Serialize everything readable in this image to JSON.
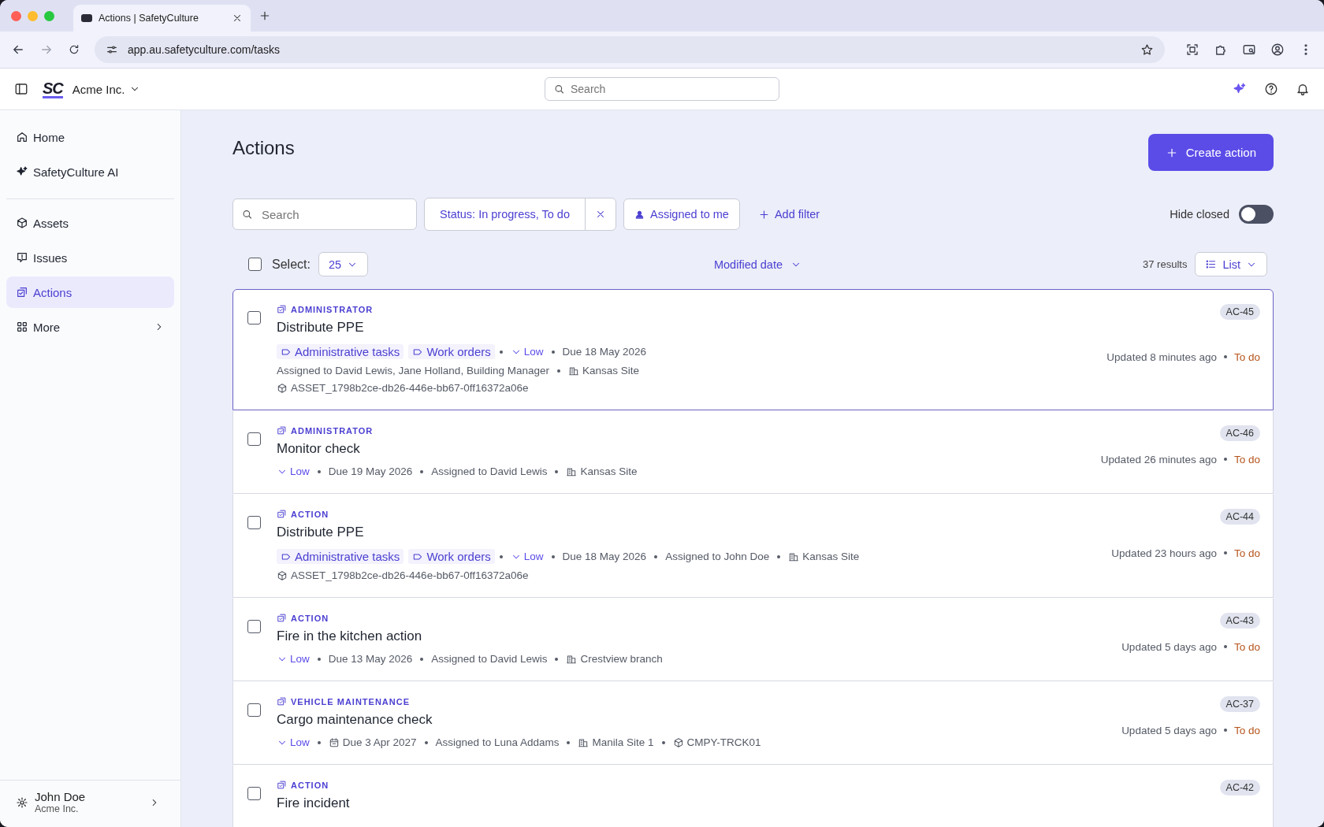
{
  "browser": {
    "tab_title": "Actions | SafetyCulture",
    "url": "app.au.safetyculture.com/tasks"
  },
  "header": {
    "logo": "SC",
    "org": "Acme Inc.",
    "search_placeholder": "Search"
  },
  "sidebar": {
    "groups": [
      [
        {
          "label": "Home",
          "selected": false,
          "expandable": false
        },
        {
          "label": "SafetyCulture AI",
          "selected": false,
          "expandable": false
        }
      ],
      [
        {
          "label": "Assets",
          "selected": false,
          "expandable": false
        },
        {
          "label": "Issues",
          "selected": false,
          "expandable": false
        },
        {
          "label": "Actions",
          "selected": true,
          "expandable": false
        },
        {
          "label": "More",
          "selected": false,
          "expandable": true
        }
      ]
    ],
    "user": {
      "name": "John Doe",
      "org": "Acme Inc."
    }
  },
  "page": {
    "title": "Actions",
    "create_button": "Create action"
  },
  "filters": {
    "search_placeholder": "Search",
    "status_filter": "Status: In progress, To do",
    "assigned_filter": "Assigned to me",
    "add_filter": "Add filter",
    "hide_closed": {
      "label": "Hide closed",
      "on": false
    }
  },
  "list_bar": {
    "select_all_checked": false,
    "select_label": "Select:",
    "page_size": "25",
    "sort": "Modified date",
    "results": "37 results",
    "view": "List"
  },
  "rows": [
    {
      "category": "ADMINISTRATOR",
      "title": "Distribute PPE",
      "selected": true,
      "checked": false,
      "id": "AC-45",
      "updated": "Updated 8 minutes ago",
      "status": "To do",
      "meta_lines": [
        [
          {
            "kind": "label",
            "text": "Administrative tasks"
          },
          {
            "kind": "label",
            "text": "Work orders"
          },
          {
            "kind": "priority",
            "text": "Low"
          },
          {
            "kind": "text",
            "text": "Due 18 May 2026"
          }
        ],
        [
          {
            "kind": "text",
            "text": "Assigned to David Lewis, Jane Holland, Building Manager"
          },
          {
            "kind": "site",
            "text": "Kansas Site"
          }
        ],
        [
          {
            "kind": "asset",
            "text": "ASSET_1798b2ce-db26-446e-bb67-0ff16372a06e"
          }
        ]
      ]
    },
    {
      "category": "ADMINISTRATOR",
      "title": "Monitor check",
      "selected": false,
      "checked": false,
      "id": "AC-46",
      "updated": "Updated 26 minutes ago",
      "status": "To do",
      "meta_lines": [
        [
          {
            "kind": "priority",
            "text": "Low"
          },
          {
            "kind": "text",
            "text": "Due 19 May 2026"
          },
          {
            "kind": "text",
            "text": "Assigned to David Lewis"
          },
          {
            "kind": "site",
            "text": "Kansas Site"
          }
        ]
      ]
    },
    {
      "category": "ACTION",
      "title": "Distribute PPE",
      "selected": false,
      "checked": false,
      "id": "AC-44",
      "updated": "Updated 23 hours ago",
      "status": "To do",
      "meta_lines": [
        [
          {
            "kind": "label",
            "text": "Administrative tasks"
          },
          {
            "kind": "label",
            "text": "Work orders"
          },
          {
            "kind": "priority",
            "text": "Low"
          },
          {
            "kind": "text",
            "text": "Due 18 May 2026"
          },
          {
            "kind": "text",
            "text": "Assigned to John Doe"
          },
          {
            "kind": "site",
            "text": "Kansas Site"
          }
        ],
        [
          {
            "kind": "asset",
            "text": "ASSET_1798b2ce-db26-446e-bb67-0ff16372a06e"
          }
        ]
      ]
    },
    {
      "category": "ACTION",
      "title": "Fire in the kitchen action",
      "selected": false,
      "checked": false,
      "id": "AC-43",
      "updated": "Updated 5 days ago",
      "status": "To do",
      "meta_lines": [
        [
          {
            "kind": "priority",
            "text": "Low"
          },
          {
            "kind": "text",
            "text": "Due 13 May 2026"
          },
          {
            "kind": "text",
            "text": "Assigned to David Lewis"
          },
          {
            "kind": "site",
            "text": "Crestview branch"
          }
        ]
      ]
    },
    {
      "category": "VEHICLE MAINTENANCE",
      "title": "Cargo maintenance check",
      "selected": false,
      "checked": false,
      "id": "AC-37",
      "updated": "Updated 5 days ago",
      "status": "To do",
      "meta_lines": [
        [
          {
            "kind": "priority",
            "text": "Low"
          },
          {
            "kind": "date",
            "text": "Due 3 Apr 2027"
          },
          {
            "kind": "text",
            "text": "Assigned to Luna Addams"
          },
          {
            "kind": "site",
            "text": "Manila Site 1"
          },
          {
            "kind": "asset",
            "text": "CMPY-TRCK01"
          }
        ]
      ]
    },
    {
      "category": "ACTION",
      "title": "Fire incident",
      "selected": false,
      "checked": false,
      "id": "AC-42",
      "meta_lines": []
    }
  ]
}
